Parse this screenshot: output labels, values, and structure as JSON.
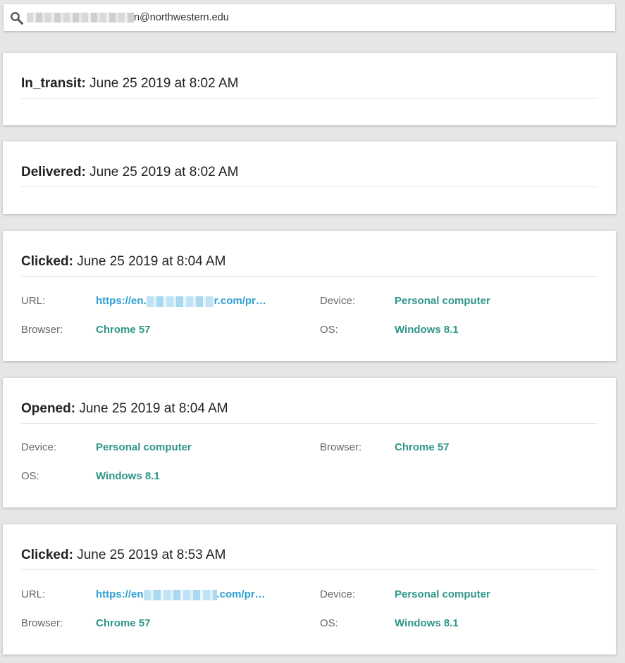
{
  "search": {
    "value_prefix": "",
    "value_suffix": "n@northwestern.edu"
  },
  "events": [
    {
      "type": "In_transit:",
      "time": "June 25 2019 at 8:02 AM"
    },
    {
      "type": "Delivered:",
      "time": "June 25 2019 at 8:02 AM"
    },
    {
      "type": "Clicked:",
      "time": "June 25 2019 at 8:04 AM",
      "url_label": "URL:",
      "url_start": "https://en.",
      "url_end": "r.com/pr…",
      "device_label": "Device:",
      "device": "Personal computer",
      "browser_label": "Browser:",
      "browser": "Chrome 57",
      "os_label": "OS:",
      "os": "Windows 8.1"
    },
    {
      "type": "Opened:",
      "time": "June 25 2019 at 8:04 AM",
      "device_label": "Device:",
      "device": "Personal computer",
      "browser_label": "Browser:",
      "browser": "Chrome 57",
      "os_label": "OS:",
      "os": "Windows 8.1"
    },
    {
      "type": "Clicked:",
      "time": "June 25 2019 at 8:53 AM",
      "url_label": "URL:",
      "url_start": "https://en",
      "url_end": ".com/pr…",
      "device_label": "Device:",
      "device": "Personal computer",
      "browser_label": "Browser:",
      "browser": "Chrome 57",
      "os_label": "OS:",
      "os": "Windows 8.1"
    }
  ],
  "colors": {
    "background": "#e6e6e6",
    "card": "#ffffff",
    "value_green": "#2f9688",
    "link_blue": "#2e9fd3"
  }
}
